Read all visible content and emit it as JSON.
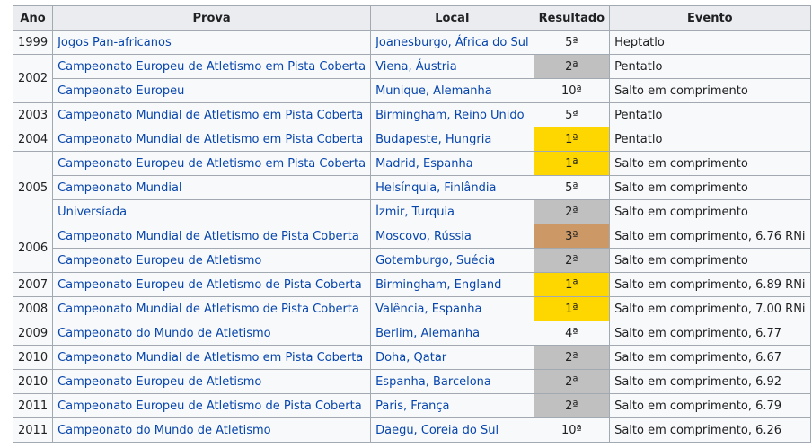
{
  "headers": {
    "ano": "Ano",
    "prova": "Prova",
    "local": "Local",
    "resultado": "Resultado",
    "evento": "Evento"
  },
  "rows": [
    {
      "ano": "1999",
      "prova": "Jogos Pan-africanos",
      "local": "Joanesburgo, África do Sul",
      "resultado": "5ª",
      "evento": "Heptatlo"
    },
    {
      "ano": "2002",
      "prova": "Campeonato Europeu de Atletismo em Pista Coberta",
      "local": "Viena, Áustria",
      "resultado": "2ª",
      "evento": "Pentatlo"
    },
    {
      "ano": "",
      "prova": "Campeonato Europeu",
      "local": "Munique, Alemanha",
      "resultado": "10ª",
      "evento": "Salto em comprimento"
    },
    {
      "ano": "2003",
      "prova": "Campeonato Mundial de Atletismo em Pista Coberta",
      "local": "Birmingham, Reino Unido",
      "resultado": "5ª",
      "evento": "Pentatlo"
    },
    {
      "ano": "2004",
      "prova": "Campeonato Mundial de Atletismo em Pista Coberta",
      "local": "Budapeste, Hungria",
      "resultado": "1ª",
      "evento": "Pentatlo"
    },
    {
      "ano": "2005",
      "prova": "Campeonato Europeu de Atletismo em Pista Coberta",
      "local": "Madrid, Espanha",
      "resultado": "1ª",
      "evento": "Salto em comprimento"
    },
    {
      "ano": "",
      "prova": "Campeonato Mundial",
      "local": "Helsínquia, Finlândia",
      "resultado": "5ª",
      "evento": "Salto em comprimento"
    },
    {
      "ano": "",
      "prova": "Universíada",
      "local": "İzmir, Turquia",
      "resultado": "2ª",
      "evento": "Salto em comprimento"
    },
    {
      "ano": "2006",
      "prova": "Campeonato Mundial de Atletismo de Pista Coberta",
      "local": "Moscovo, Rússia",
      "resultado": "3ª",
      "evento": "Salto em comprimento, 6.76 RNi"
    },
    {
      "ano": "",
      "prova": "Campeonato Europeu de Atletismo",
      "local": "Gotemburgo, Suécia",
      "resultado": "2ª",
      "evento": "Salto em comprimento"
    },
    {
      "ano": "2007",
      "prova": "Campeonato Europeu de Atletismo de Pista Coberta",
      "local": "Birmingham, England",
      "resultado": "1ª",
      "evento": "Salto em comprimento, 6.89 RNi"
    },
    {
      "ano": "2008",
      "prova": "Campeonato Mundial de Atletismo de Pista Coberta",
      "local": "Valência, Espanha",
      "resultado": "1ª",
      "evento": "Salto em comprimento, 7.00 RNi"
    },
    {
      "ano": "2009",
      "prova": "Campeonato do Mundo de Atletismo",
      "local": "Berlim, Alemanha",
      "resultado": "4ª",
      "evento": "Salto em comprimento, 6.77"
    },
    {
      "ano": "2010",
      "prova": "Campeonato Mundial de Atletismo em Pista Coberta",
      "local": "Doha, Qatar",
      "resultado": "2ª",
      "evento": "Salto em comprimento, 6.67"
    },
    {
      "ano": "2010",
      "prova": "Campeonato Europeu de Atletismo",
      "local": "Espanha, Barcelona",
      "resultado": "2ª",
      "evento": "Salto em comprimento, 6.92"
    },
    {
      "ano": "2011",
      "prova": "Campeonato Europeu de Atletismo de Pista Coberta",
      "local": "Paris, França",
      "resultado": "2ª",
      "evento": "Salto em comprimento, 6.79"
    },
    {
      "ano": "2011",
      "prova": "Campeonato do Mundo de Atletismo",
      "local": "Daegu, Coreia do Sul",
      "resultado": "10ª",
      "evento": "Salto em comprimento, 6.26"
    }
  ],
  "medal_colors": {
    "gold": "#ffd700",
    "silver": "#c0c0c0",
    "bronze": "#cc9966"
  }
}
